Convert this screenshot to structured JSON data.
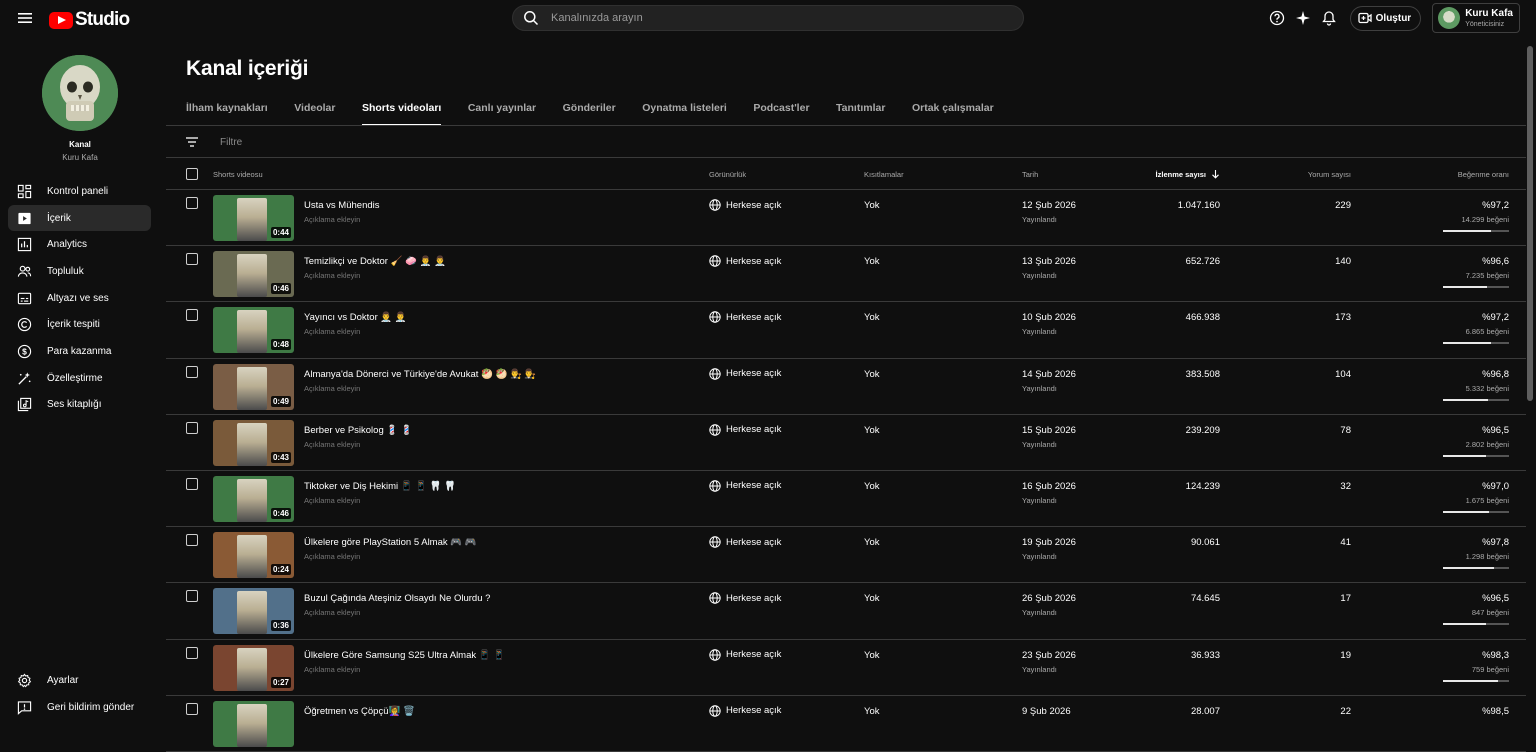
{
  "app": {
    "logo_text": "Studio"
  },
  "colors": {
    "brand": "#ff0000",
    "background": "#0f0f0f",
    "active_nav": "#2a2a2a"
  },
  "search": {
    "placeholder": "Kanalınızda arayın"
  },
  "header": {
    "create_label": "Oluştur"
  },
  "account": {
    "name": "Kuru Kafa",
    "role": "Yöneticisiniz"
  },
  "channel": {
    "title": "Kanal",
    "name": "Kuru Kafa"
  },
  "sidebar": {
    "items": [
      {
        "label": "Kontrol paneli",
        "icon": "dashboard-icon"
      },
      {
        "label": "İçerik",
        "icon": "content-icon",
        "active": true
      },
      {
        "label": "Analytics",
        "icon": "analytics-icon"
      },
      {
        "label": "Topluluk",
        "icon": "community-icon"
      },
      {
        "label": "Altyazı ve ses",
        "icon": "subtitles-icon"
      },
      {
        "label": "İçerik tespiti",
        "icon": "copyright-icon"
      },
      {
        "label": "Para kazanma",
        "icon": "dollar-icon"
      },
      {
        "label": "Özelleştirme",
        "icon": "magic-wand-icon"
      },
      {
        "label": "Ses kitaplığı",
        "icon": "audio-library-icon"
      }
    ],
    "bottom": [
      {
        "label": "Ayarlar",
        "icon": "gear-icon"
      },
      {
        "label": "Geri bildirim gönder",
        "icon": "feedback-icon"
      }
    ]
  },
  "page": {
    "title": "Kanal içeriği"
  },
  "tabs": [
    "İlham kaynakları",
    "Videolar",
    "Shorts videoları",
    "Canlı yayınlar",
    "Gönderiler",
    "Oynatma listeleri",
    "Podcast'ler",
    "Tanıtımlar",
    "Ortak çalışmalar"
  ],
  "active_tab": "Shorts videoları",
  "filter": {
    "placeholder": "Filtre"
  },
  "table": {
    "headers": {
      "video": "Shorts videosu",
      "visibility": "Görünürlük",
      "restrictions": "Kısıtlamalar",
      "date": "Tarih",
      "views": "İzlenme sayısı",
      "comments": "Yorum sayısı",
      "likes": "Beğenme oranı"
    },
    "rows": [
      {
        "title": "Usta vs Mühendis",
        "desc": "Açıklama ekleyin",
        "duration": "0:44",
        "visibility": "Herkese açık",
        "restrictions": "Yok",
        "date": "12 Şub 2026",
        "status": "Yayınlandı",
        "views": "1.047.160",
        "comments": "229",
        "like_pct": "%97,2",
        "likes": "14.299 beğeni",
        "like_ratio": 97.2,
        "thumb_color": "#3f7a45"
      },
      {
        "title": "Temizlikçi ve Doktor 🧹 🧼 👨‍⚕️ 👨‍⚕️",
        "desc": "Açıklama ekleyin",
        "duration": "0:46",
        "visibility": "Herkese açık",
        "restrictions": "Yok",
        "date": "13 Şub 2026",
        "status": "Yayınlandı",
        "views": "652.726",
        "comments": "140",
        "like_pct": "%96,6",
        "likes": "7.235 beğeni",
        "like_ratio": 96.6,
        "thumb_color": "#6a6a52"
      },
      {
        "title": "Yayıncı vs Doktor 👨‍⚕️ 👨‍⚕️",
        "desc": "Açıklama ekleyin",
        "duration": "0:48",
        "visibility": "Herkese açık",
        "restrictions": "Yok",
        "date": "10 Şub 2026",
        "status": "Yayınlandı",
        "views": "466.938",
        "comments": "173",
        "like_pct": "%97,2",
        "likes": "6.865 beğeni",
        "like_ratio": 97.2,
        "thumb_color": "#3f7a45"
      },
      {
        "title": "Almanya'da Dönerci ve Türkiye'de Avukat 🥙 🥙 👨‍⚖️ 👨‍⚖️",
        "desc": "Açıklama ekleyin",
        "duration": "0:49",
        "visibility": "Herkese açık",
        "restrictions": "Yok",
        "date": "14 Şub 2026",
        "status": "Yayınlandı",
        "views": "383.508",
        "comments": "104",
        "like_pct": "%96,8",
        "likes": "5.332 beğeni",
        "like_ratio": 96.8,
        "thumb_color": "#7a5d45"
      },
      {
        "title": "Berber ve Psikolog 💈 💈",
        "desc": "Açıklama ekleyin",
        "duration": "0:43",
        "visibility": "Herkese açık",
        "restrictions": "Yok",
        "date": "15 Şub 2026",
        "status": "Yayınlandı",
        "views": "239.209",
        "comments": "78",
        "like_pct": "%96,5",
        "likes": "2.802 beğeni",
        "like_ratio": 96.5,
        "thumb_color": "#7a5a3a"
      },
      {
        "title": "Tiktoker ve Diş Hekimi 📱 📱 🦷 🦷",
        "desc": "Açıklama ekleyin",
        "duration": "0:46",
        "visibility": "Herkese açık",
        "restrictions": "Yok",
        "date": "16 Şub 2026",
        "status": "Yayınlandı",
        "views": "124.239",
        "comments": "32",
        "like_pct": "%97,0",
        "likes": "1.675 beğeni",
        "like_ratio": 97.0,
        "thumb_color": "#3f7a45"
      },
      {
        "title": "Ülkelere göre PlayStation 5 Almak 🎮 🎮",
        "desc": "Açıklama ekleyin",
        "duration": "0:24",
        "visibility": "Herkese açık",
        "restrictions": "Yok",
        "date": "19 Şub 2026",
        "status": "Yayınlandı",
        "views": "90.061",
        "comments": "41",
        "like_pct": "%97,8",
        "likes": "1.298 beğeni",
        "like_ratio": 97.8,
        "thumb_color": "#8a5a35"
      },
      {
        "title": "Buzul Çağında Ateşiniz Olsaydı Ne Olurdu ?",
        "desc": "Açıklama ekleyin",
        "duration": "0:36",
        "visibility": "Herkese açık",
        "restrictions": "Yok",
        "date": "26 Şub 2026",
        "status": "Yayınlandı",
        "views": "74.645",
        "comments": "17",
        "like_pct": "%96,5",
        "likes": "847 beğeni",
        "like_ratio": 96.5,
        "thumb_color": "#52708a"
      },
      {
        "title": "Ülkelere Göre Samsung S25 Ultra Almak 📱 📱",
        "desc": "Açıklama ekleyin",
        "duration": "0:27",
        "visibility": "Herkese açık",
        "restrictions": "Yok",
        "date": "23 Şub 2026",
        "status": "Yayınlandı",
        "views": "36.933",
        "comments": "19",
        "like_pct": "%98,3",
        "likes": "759 beğeni",
        "like_ratio": 98.3,
        "thumb_color": "#7a4530"
      },
      {
        "title": "Öğretmen vs Çöpçü👩‍🏫 🗑️",
        "desc": "",
        "duration": "",
        "visibility": "Herkese açık",
        "restrictions": "Yok",
        "date": "9 Şub 2026",
        "status": "",
        "views": "28.007",
        "comments": "22",
        "like_pct": "%98,5",
        "likes": "",
        "like_ratio": 98.5,
        "thumb_color": "#3f7a45"
      }
    ]
  }
}
